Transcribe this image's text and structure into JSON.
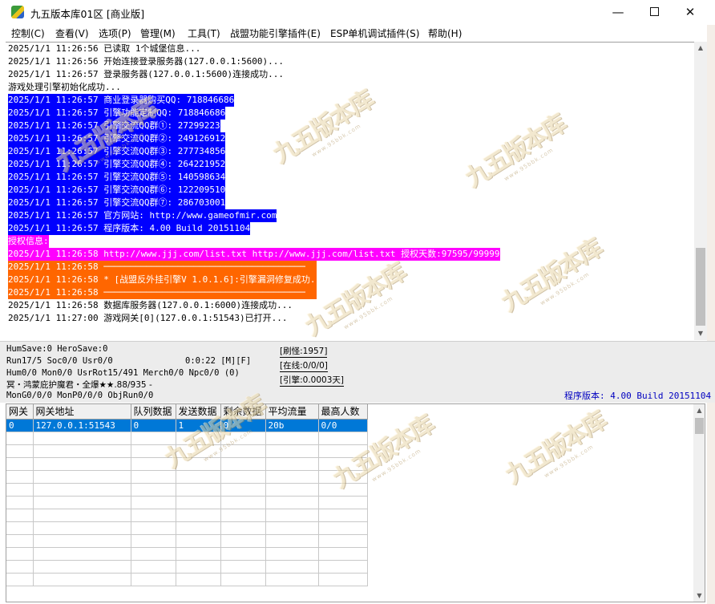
{
  "window": {
    "title": "九五版本库01区 [商业版]",
    "minimize": "—",
    "close": "✕"
  },
  "menu": [
    "控制(C)",
    "查看(V)",
    "选项(P)",
    "管理(M)",
    "工具(T)",
    "战盟功能引擎插件(E)",
    "ESP单机调试插件(S)",
    "帮助(H)"
  ],
  "log": [
    {
      "text": "2025/1/1 11:26:56 已读取 1个城堡信息...",
      "style": "normal"
    },
    {
      "text": "2025/1/1 11:26:56 开始连接登录服务器(127.0.0.1:5600)...",
      "style": "normal"
    },
    {
      "text": "2025/1/1 11:26:57 登录服务器(127.0.0.1:5600)连接成功...",
      "style": "normal"
    },
    {
      "text": "游戏处理引擎初始化成功...",
      "style": "normal"
    },
    {
      "text": "2025/1/1 11:26:57 商业登录器购买QQ: 718846686",
      "style": "blue"
    },
    {
      "text": "2025/1/1 11:26:57 引擎功能定制QQ: 718846686",
      "style": "blue"
    },
    {
      "text": "2025/1/1 11:26:57 引擎交流QQ群①: 27299223",
      "style": "blue"
    },
    {
      "text": "2025/1/1 11:26:57 引擎交流QQ群②: 249126912",
      "style": "blue"
    },
    {
      "text": "2025/1/1 11:26:57 引擎交流QQ群③: 277734856",
      "style": "blue"
    },
    {
      "text": "2025/1/1 11:26:57 引擎交流QQ群④: 264221952",
      "style": "blue"
    },
    {
      "text": "2025/1/1 11:26:57 引擎交流QQ群⑤: 140598634",
      "style": "blue"
    },
    {
      "text": "2025/1/1 11:26:57 引擎交流QQ群⑥: 122209510",
      "style": "blue"
    },
    {
      "text": "2025/1/1 11:26:57 引擎交流QQ群⑦: 286703001",
      "style": "blue"
    },
    {
      "text": "2025/1/1 11:26:57 官方网站: http://www.gameofmir.com",
      "style": "blue"
    },
    {
      "text": "2025/1/1 11:26:57 程序版本: 4.00 Build 20151104",
      "style": "blue"
    },
    {
      "text": "授权信息:",
      "style": "magenta"
    },
    {
      "text": "2025/1/1 11:26:58 http://www.jjj.com/list.txt http://www.jjj.com/list.txt 授权天数:97595/99999",
      "style": "magenta"
    },
    {
      "text": "2025/1/1 11:26:58 ──────────────────────────────────────",
      "style": "orange"
    },
    {
      "text": "2025/1/1 11:26:58 * [战盟反外挂引擎V 1.0.1.6]:引擎漏洞修复成功...",
      "style": "orange"
    },
    {
      "text": "2025/1/1 11:26:58 ──────────────────────────────────────",
      "style": "orange"
    },
    {
      "text": "2025/1/1 11:26:58 数据库服务器(127.0.0.1:6000)连接成功...",
      "style": "normal"
    },
    {
      "text": "2025/1/1 11:27:00 游戏网关[0](127.0.0.1:51543)已打开...",
      "style": "normal"
    }
  ],
  "status": {
    "line1": "HumSave:0 HeroSave:0",
    "line2": "Run17/5 Soc0/0 Usr0/0",
    "timer": "0:0:22 [M][F]",
    "line3": "Hum0/0 Mon0/0 UsrRot15/491 Merch0/0 Npc0/0 (0)",
    "line4": "冥・鸿蒙庇护魔君・全爆★★.88/935 -",
    "line5": "MonG0/0/0 MonP0/0/0 ObjRun0/0",
    "refresh": "[刷怪:1957]",
    "online": "[在线:0/0/0]",
    "engine": "[引擎:0.0003天]",
    "version": "程序版本: 4.00 Build 20151104"
  },
  "gateway_table": {
    "headers": [
      "网关",
      "网关地址",
      "队列数据",
      "发送数据",
      "剩余数据",
      "平均流量",
      "最高人数"
    ],
    "rows": [
      [
        "0",
        "127.0.0.1:51543",
        "0",
        "1",
        "0",
        "20b",
        "0/0"
      ]
    ]
  },
  "watermark": {
    "text": "九五版本库",
    "url": "www.95bbk.com"
  },
  "colors": {
    "log_blue": "#0000ff",
    "log_magenta": "#ff00ff",
    "log_orange": "#ff6600",
    "selection": "#0078d7",
    "version_text": "#0000c0"
  }
}
